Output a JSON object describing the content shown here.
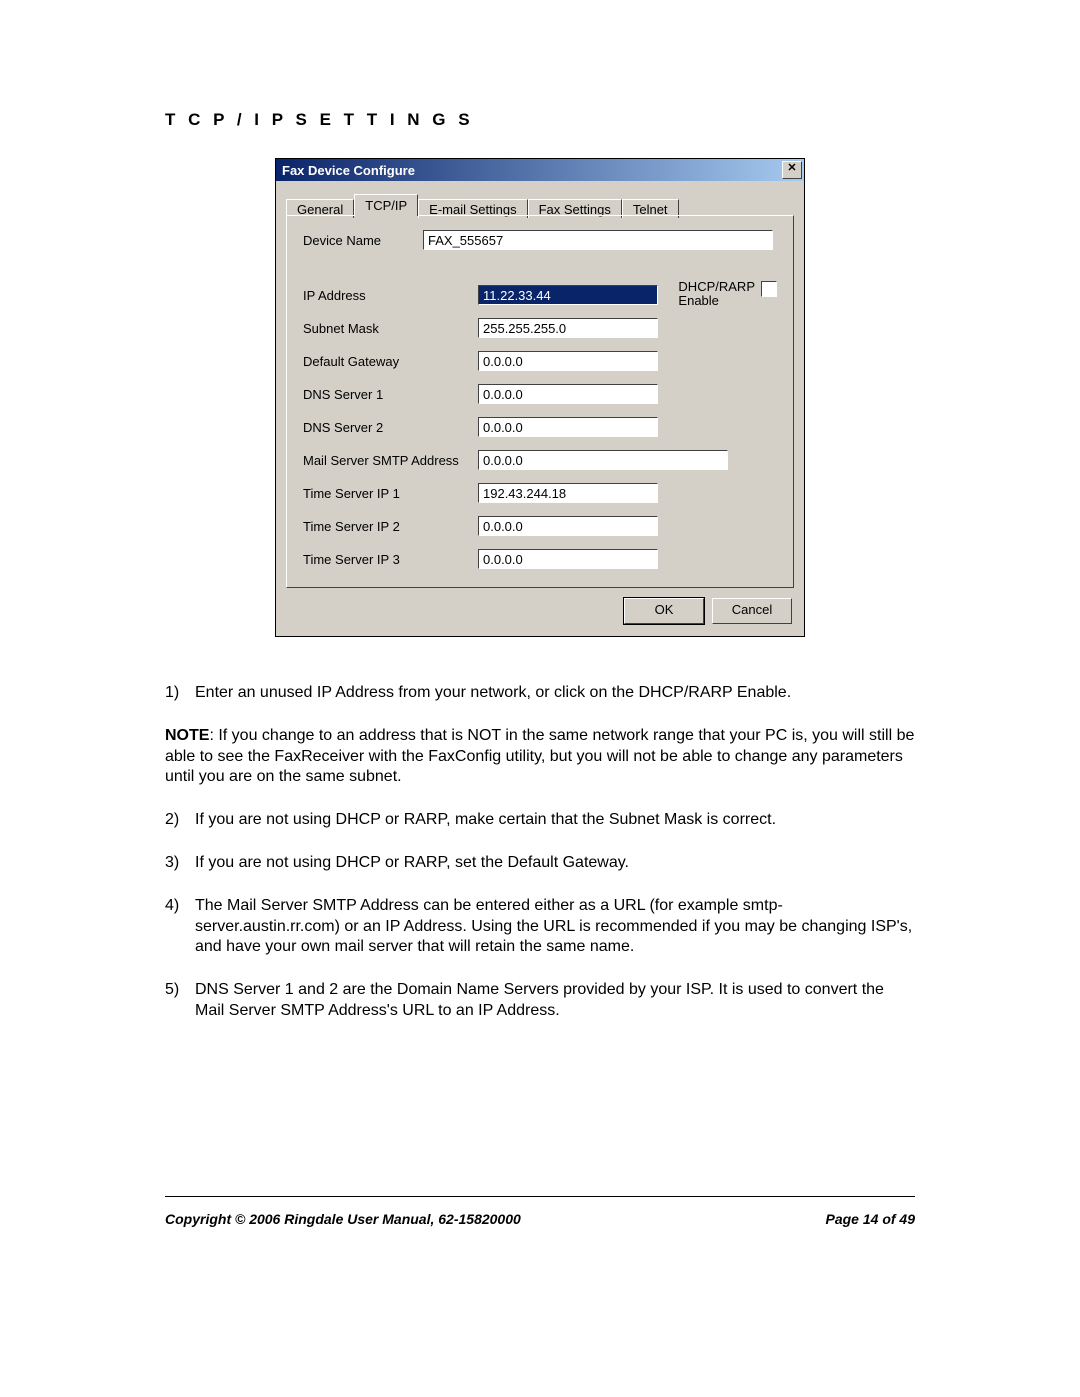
{
  "heading": "T C P / I P  S E T T I N G S",
  "dialog": {
    "title": "Fax Device Configure",
    "close_glyph": "✕",
    "tabs": [
      "General",
      "TCP/IP",
      "E-mail Settings",
      "Fax Settings",
      "Telnet"
    ],
    "active_tab": 1,
    "device_name_label": "Device Name",
    "device_name_value": "FAX_555657",
    "dhcp_label_line1": "DHCP/RARP",
    "dhcp_label_line2": "Enable",
    "fields": [
      {
        "label": "IP Address",
        "value": "11.22.33.44",
        "selected": true
      },
      {
        "label": "Subnet Mask",
        "value": "255.255.255.0",
        "selected": false
      },
      {
        "label": "Default Gateway",
        "value": "0.0.0.0",
        "selected": false
      },
      {
        "label": "DNS Server 1",
        "value": "0.0.0.0",
        "selected": false
      },
      {
        "label": "DNS Server 2",
        "value": "0.0.0.0",
        "selected": false
      },
      {
        "label": "Mail Server SMTP Address",
        "value": "0.0.0.0",
        "selected": false
      },
      {
        "label": "Time Server IP 1",
        "value": "192.43.244.18",
        "selected": false
      },
      {
        "label": "Time Server IP 2",
        "value": "0.0.0.0",
        "selected": false
      },
      {
        "label": "Time Server IP 3",
        "value": "0.0.0.0",
        "selected": false
      }
    ],
    "ok_label": "OK",
    "cancel_label": "Cancel"
  },
  "instructions": {
    "item1_num": "1)",
    "item1_text": "Enter an unused IP Address from your network, or click on the DHCP/RARP Enable.",
    "note_label": "NOTE",
    "note_text": ": If you change to an address that is NOT in the same network range that your PC is, you will still be able to see the FaxReceiver with the FaxConfig utility, but you will not be able to change any parameters until you are on the same subnet.",
    "item2_num": "2)",
    "item2_text": "If you are not using DHCP or RARP, make certain that the Subnet Mask is correct.",
    "item3_num": "3)",
    "item3_text": "If you are not using DHCP or RARP, set the Default Gateway.",
    "item4_num": "4)",
    "item4_text": "The Mail Server SMTP Address can be entered either as a URL (for example smtp-server.austin.rr.com) or an IP Address. Using the URL is recommended if you may be changing ISP's, and have your own mail server that will retain the same name.",
    "item5_num": "5)",
    "item5_text": "DNS Server 1 and 2 are the Domain Name Servers provided by your ISP. It is used to convert the Mail Server SMTP Address's URL to an IP Address."
  },
  "footer": {
    "left": "Copyright © 2006 Ringdale   User Manual, 62-15820000",
    "right": "Page 14 of 49"
  }
}
